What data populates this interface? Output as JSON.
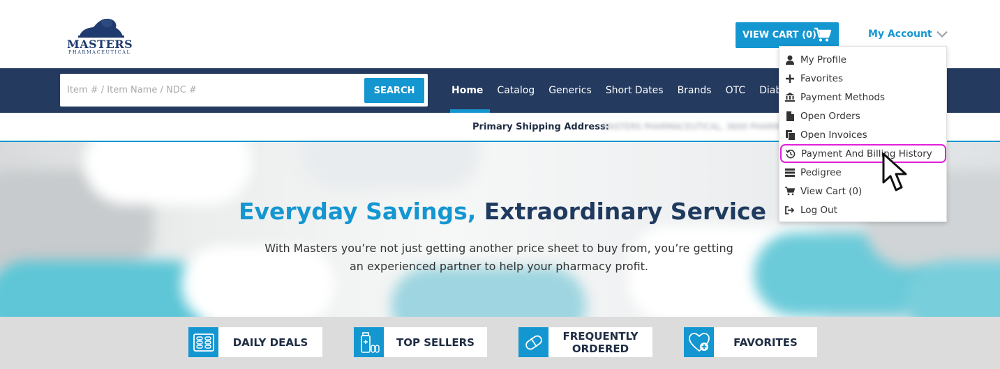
{
  "header": {
    "logo_text": "MASTERS",
    "logo_sub": "PHARMACEUTICAL",
    "view_cart_label": "VIEW CART (0)",
    "account_label": "My Account"
  },
  "search": {
    "placeholder": "Item # / Item Name / NDC #",
    "button_label": "SEARCH"
  },
  "nav": {
    "items": [
      {
        "label": "Home",
        "active": true
      },
      {
        "label": "Catalog"
      },
      {
        "label": "Generics"
      },
      {
        "label": "Short Dates"
      },
      {
        "label": "Brands"
      },
      {
        "label": "OTC"
      },
      {
        "label": "Diabetic"
      }
    ]
  },
  "address": {
    "label": "Primary Shipping Address:",
    "value": "MASTERS PHARMACEUTICAL, 3600 PHARMA WAY"
  },
  "hero": {
    "title_part1": "Everyday Savings,",
    "title_part2": "Extraordinary Service",
    "line1": "With Masters you’re not just getting another price sheet to buy from, you’re getting",
    "line2": "an experienced partner to help your pharmacy profit."
  },
  "quick_links": [
    {
      "label": "DAILY DEALS",
      "icon": "pill-pack-icon"
    },
    {
      "label": "TOP SELLERS",
      "icon": "bottle-icon"
    },
    {
      "label_line1": "FREQUENTLY",
      "label_line2": "ORDERED",
      "icon": "capsule-icon"
    },
    {
      "label": "FAVORITES",
      "icon": "heart-plus-icon"
    }
  ],
  "account_menu": {
    "items": [
      {
        "label": "My Profile",
        "icon": "user-icon"
      },
      {
        "label": "Favorites",
        "icon": "plus-icon"
      },
      {
        "label": "Payment Methods",
        "icon": "bank-icon"
      },
      {
        "label": "Open Orders",
        "icon": "document-icon"
      },
      {
        "label": "Open Invoices",
        "icon": "documents-icon"
      },
      {
        "label": "Payment And Billing History",
        "icon": "history-icon",
        "highlighted": true
      },
      {
        "label": "Pedigree",
        "icon": "server-icon"
      },
      {
        "label": "View Cart (0)",
        "icon": "cart-icon"
      },
      {
        "label": "Log Out",
        "icon": "logout-icon"
      }
    ]
  },
  "colors": {
    "accent": "#1496d1",
    "navy": "#243a5e",
    "highlight": "#e020d8"
  }
}
